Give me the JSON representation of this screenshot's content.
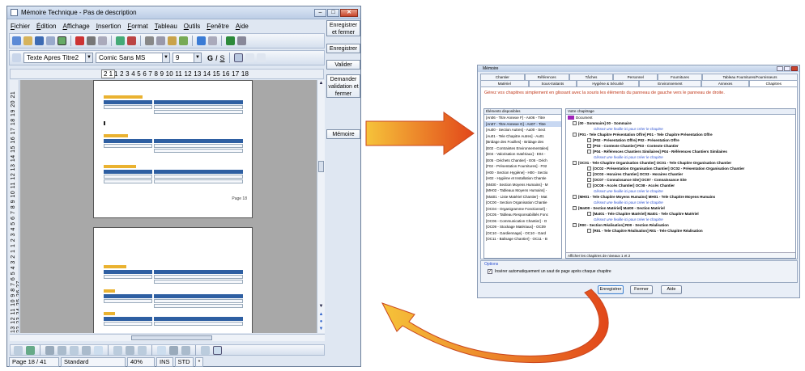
{
  "left_window": {
    "title": "Mémoire Technique - Pas de description",
    "window_buttons": [
      "–",
      "□",
      "✕"
    ],
    "menu": [
      "Fichier",
      "Édition",
      "Affichage",
      "Insertion",
      "Format",
      "Tableau",
      "Outils",
      "Fenêtre",
      "Aide"
    ],
    "toolbar2": {
      "style_value": "Texte Apres Titre2",
      "font_value": "Comic Sans MS",
      "size_value": "9"
    },
    "side_buttons": {
      "save_close": "Enregistrer et fermer",
      "save": "Enregistrer",
      "validate": "Valider",
      "request_validation": "Demander validation et fermer",
      "memoire": "Mémoire"
    },
    "ruler": {
      "page_box": "2 1",
      "numbers": "1 2 3 4 5 6 7 8 9 10 11 12 13 14 15 16 17 18"
    },
    "vertical_ruler": "13 12 11 10 9 8 7 6 5 4 3 2 1  1 2 3 4 5 6 7 8 9 10 11 12 13 14 15 16 17 18 19 20 21 22 23 24 25 26 27",
    "page_footer": "Page 18",
    "status": {
      "page": "Page 18 / 41",
      "style": "Standard",
      "zoom": "40%",
      "ins": "INS",
      "std": "STD",
      "star": "*"
    }
  },
  "right_window": {
    "title": "Mémoire",
    "tabs_row1": [
      "Chantier",
      "Références",
      "Tâches",
      "Personnel",
      "Fournitures",
      "Tableau Fournitures/Fournisseurs"
    ],
    "tabs_row2": [
      "Matériel",
      "Sous-traitants",
      "Hygiène & Sécurité",
      "Environnement",
      "Annexes",
      "Chapitres"
    ],
    "instruction": "Gérez vos chapitres simplement en glissant avec la souris les éléments du panneau de gauche vers le panneau de droite.",
    "left_panel": {
      "title": "Éléments disponibles",
      "items": [
        "[An06 - Titre Annexe F] - An06 - Titre",
        "[An07 - Titre Annexe G] - An07 - Titre",
        "[Au00 - Section Autres] - Au00 - Sect",
        "[Au01 - Tele Chapitre Autres] - Au01",
        "[Bridage des Fouilles] - Bridage des",
        "[E02 - Contraintes Environnementales]",
        "[E04 - Valorisation matériaux] - E04 -",
        "[E05 - Déchets Chantier] - E05 - Déch",
        "[F02 - Présentation Fournitures] - F02",
        "[H00 - Section Hygiène] - H00 - Sectio",
        "[H02 - Hygiène et Installation Chantie",
        "[M400 - Section Moyens Humains] - M",
        "[MH02 - Tableaux Moyens Humains] -",
        "[Mat01 - Liste Matériel Chantier] - Mat",
        "[OC00 - Section Organisation Chantie",
        "[OC04 - Organigramme Fonctionnel] -",
        "[OC05 - Tableau Responsabilités Fonc",
        "[OC06 - Communication Chantier] - O",
        "[OC09 - Stockage Matériaux] - OC09",
        "[OC10 - Gardiennage] - OC10 - Gard",
        "[OC11 - Balisage Chantier] - OC11 - B"
      ]
    },
    "right_panel": {
      "title": "Votre chapitrage",
      "root": "Document",
      "items": [
        {
          "kind": "h",
          "text": "[00 - Sommaire]  00 - Sommaire"
        },
        {
          "kind": "hint",
          "text": "Glissez une feuille ici pour créer le chapitre"
        },
        {
          "kind": "h",
          "text": "[P01 - Tele Chapitre Présentation Offre]  P01 - Tele Chapitre Présentation Offre"
        },
        {
          "kind": "c",
          "text": "[P02 - Présentation Offre]  P02 - Présentation Offre"
        },
        {
          "kind": "c",
          "text": "[P03 - Contexte Chantier]  P03 - Contexte Chantier"
        },
        {
          "kind": "c",
          "text": "[P04 - Références Chantiers Similaires]  P04 - Références Chantiers Similaires"
        },
        {
          "kind": "hint",
          "text": "Glissez une feuille ici pour créer le chapitre"
        },
        {
          "kind": "h",
          "text": "[OC01 - Tele Chapitre Organisation Chantier]  OC01 - Tele Chapitre Organisation Chantier"
        },
        {
          "kind": "c",
          "text": "[OC02 - Présentation Organisation Chantier]  OC02 - Présentation Organisation Chantier"
        },
        {
          "kind": "c",
          "text": "[OC03 - Horaires Chantier]  OC03 - Horaires Chantier"
        },
        {
          "kind": "c",
          "text": "[OC07 - Connaissance Site]  OC07 - Connaissance Site"
        },
        {
          "kind": "c",
          "text": "[OC08 - Accès Chantier]  OC08 - Accès Chantier"
        },
        {
          "kind": "hint",
          "text": "Glissez une feuille ici pour créer le chapitre"
        },
        {
          "kind": "h",
          "text": "[MH01 - Tele Chapitre Moyens Humains]  MH01 - Tele Chapitre Moyens Humains"
        },
        {
          "kind": "hint",
          "text": "Glissez une feuille ici pour créer le chapitre"
        },
        {
          "kind": "h",
          "text": "[Mat00 - Section Matériel]  Mat00 - Section Matériel"
        },
        {
          "kind": "c",
          "text": "[Mat01 - Tele Chapitre Matériel]  Mat01 - Tele Chapitre Matériel"
        },
        {
          "kind": "hint",
          "text": "Glissez une feuille ici pour créer le chapitre"
        },
        {
          "kind": "h",
          "text": "[R00 - Section Réalisation]  R00 - Section Réalisation"
        },
        {
          "kind": "c",
          "text": "[R01 - Tele Chapitre Réalisation]  R01 - Tele Chapitre Réalisation"
        }
      ],
      "footer": "Afficher les chapitres de niveaux 1 et 2"
    },
    "options": {
      "title": "Options",
      "checkbox_label": "Insérer automatiquement un saut de page après chaque chapitre",
      "checked": "✓"
    },
    "buttons": {
      "save": "Enregistrer",
      "close": "Fermer",
      "help": "Aide"
    }
  }
}
